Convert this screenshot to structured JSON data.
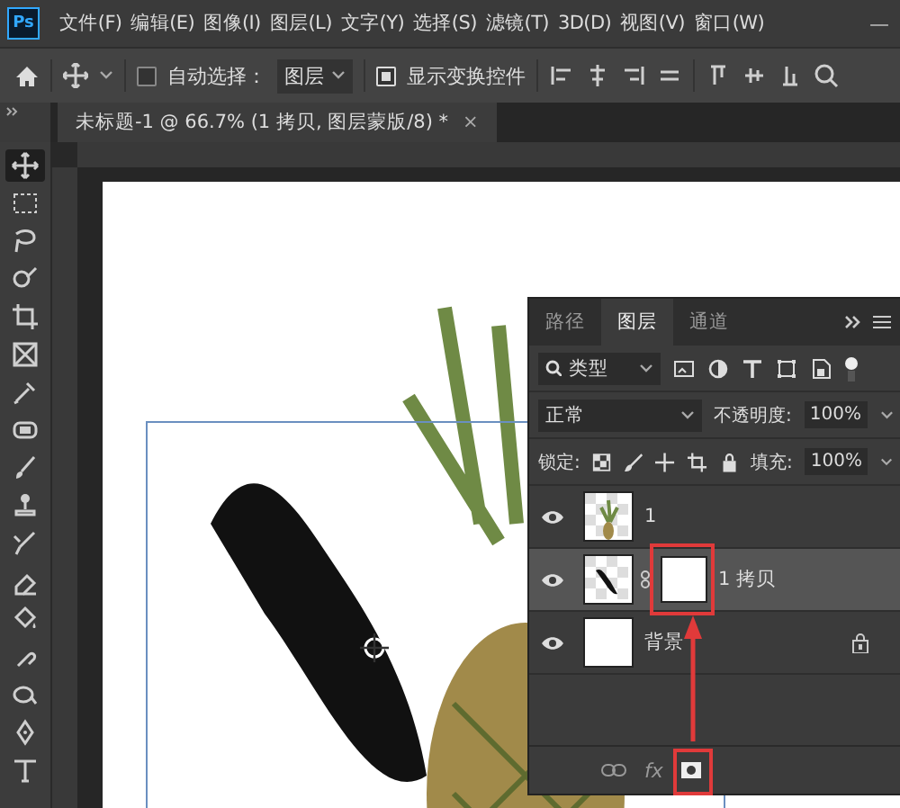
{
  "app": {
    "logo": "Ps",
    "minimize": "—"
  },
  "menu": [
    "文件(F)",
    "编辑(E)",
    "图像(I)",
    "图层(L)",
    "文字(Y)",
    "选择(S)",
    "滤镜(T)",
    "3D(D)",
    "视图(V)",
    "窗口(W)"
  ],
  "options_bar": {
    "auto_select": {
      "label": "自动选择：",
      "checked": false
    },
    "target": "图层",
    "show_transform": {
      "label": "显示变换控件",
      "checked": true
    }
  },
  "document_tab": {
    "title": "未标题-1 @ 66.7% (1 拷贝, 图层蒙版/8) *",
    "close": "×"
  },
  "tools": [
    {
      "kind": "move",
      "selected": true
    },
    {
      "kind": "marquee",
      "selected": false
    },
    {
      "kind": "lasso",
      "selected": false
    },
    {
      "kind": "quick",
      "selected": false
    },
    {
      "kind": "crop",
      "selected": false
    },
    {
      "kind": "frame",
      "selected": false
    },
    {
      "kind": "eyedropper",
      "selected": false
    },
    {
      "kind": "patch",
      "selected": false
    },
    {
      "kind": "brush",
      "selected": false
    },
    {
      "kind": "stamp",
      "selected": false
    },
    {
      "kind": "history",
      "selected": false
    },
    {
      "kind": "eraser",
      "selected": false
    },
    {
      "kind": "bucket",
      "selected": false
    },
    {
      "kind": "smudge",
      "selected": false
    },
    {
      "kind": "dodge",
      "selected": false
    },
    {
      "kind": "pen",
      "selected": false
    },
    {
      "kind": "type",
      "selected": false
    }
  ],
  "layers_panel": {
    "tabs": [
      {
        "label": "路径",
        "selected": false
      },
      {
        "label": "图层",
        "selected": true
      },
      {
        "label": "通道",
        "selected": false
      }
    ],
    "filter": "类型",
    "blend_mode": "正常",
    "opacity_label": "不透明度:",
    "opacity": "100%",
    "lock_label": "锁定:",
    "fill_label": "填充:",
    "fill": "100%",
    "fx": "fx",
    "layers": [
      {
        "name": "1",
        "kind": "pineapple",
        "visible": true,
        "selected": false,
        "mask": false,
        "locked": false
      },
      {
        "name": "1 拷贝",
        "kind": "shadow",
        "visible": true,
        "selected": true,
        "mask": true,
        "locked": false
      },
      {
        "name": "背景",
        "kind": "white",
        "visible": true,
        "selected": false,
        "mask": false,
        "locked": true
      }
    ]
  }
}
